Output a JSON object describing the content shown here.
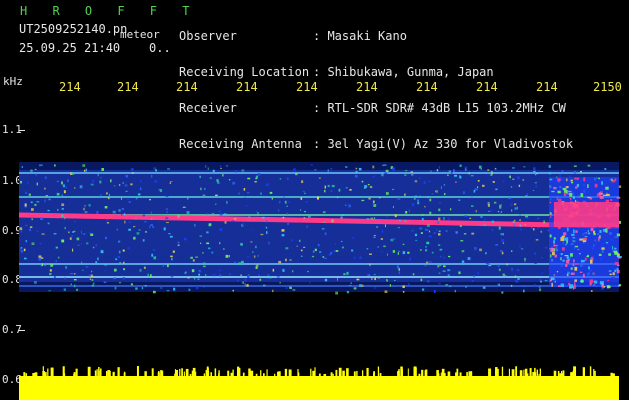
{
  "header": {
    "logo": "H R O F F T",
    "filename": "UT2509252140.pn",
    "tag": "meteor",
    "datetime": "25.09.25 21:40    0..",
    "meta_keys": [
      "Observer",
      "Receiving Location",
      "Receiver",
      "Receiving Antenna"
    ],
    "meta_vals": [
      ": Masaki Kano",
      ": Shibukawa, Gunma, Japan",
      ": RTL-SDR SDR# 43dB L15 103.2MHz CW",
      ": 3el Yagi(V) Az 330 for Vladivostok"
    ]
  },
  "axis": {
    "y_unit": "kHz",
    "y_ticks": [
      "1.1",
      "1.0",
      "0.9",
      "0.8",
      "0.7",
      "0.6"
    ],
    "x_ticks": [
      "214",
      "214",
      "214",
      "214",
      "214",
      "214",
      "214",
      "214",
      "214",
      "2150"
    ]
  },
  "colors": {
    "background": "#000000",
    "yellow": "#ffff00",
    "pink": "#ff3a88",
    "green": "#4fd34f",
    "blue": "#2f63ff"
  }
}
